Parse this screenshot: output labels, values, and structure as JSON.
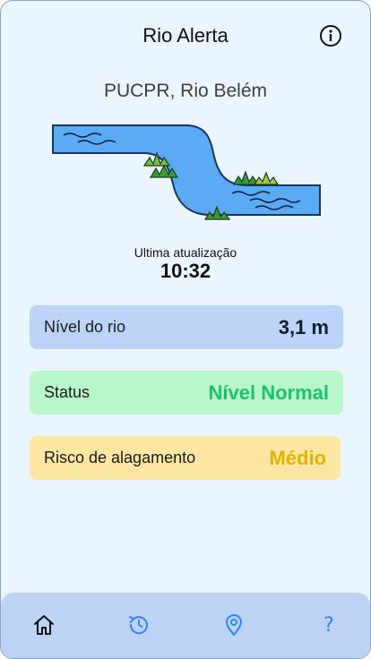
{
  "header": {
    "title": "Rio Alerta",
    "info_icon": "info-icon"
  },
  "location": {
    "name": "PUCPR, Rio Belém"
  },
  "update": {
    "label": "Ultima atualização",
    "time": "10:32"
  },
  "cards": {
    "river_level": {
      "label": "Nível do rio",
      "value": "3,1 m"
    },
    "status": {
      "label": "Status",
      "value": "Nível Normal",
      "color": "#1fc06a"
    },
    "flood_risk": {
      "label": "Risco de alagamento",
      "value": "Médio",
      "color": "#e1b300"
    }
  },
  "nav": {
    "items": [
      {
        "icon": "home-icon"
      },
      {
        "icon": "history-icon"
      },
      {
        "icon": "map-pin-icon"
      },
      {
        "icon": "help-icon",
        "glyph": "?"
      }
    ]
  },
  "colors": {
    "background": "#eaf5fe",
    "river": "#5aaaf5",
    "nav_bg": "#bcd3f6",
    "accent": "#2f86f0"
  }
}
